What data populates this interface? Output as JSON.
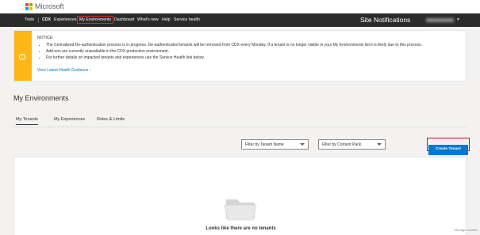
{
  "brand": {
    "name": "Microsoft",
    "logo_colors": [
      "#f25022",
      "#7fba00",
      "#00a4ef",
      "#ffb900"
    ]
  },
  "nav": {
    "items": [
      {
        "label": "Tools"
      },
      {
        "label": "CDX"
      },
      {
        "label": "Experiences"
      },
      {
        "label": "My Environments",
        "active": true
      },
      {
        "label": "Dashboard"
      },
      {
        "label": "What's new"
      },
      {
        "label": "Help"
      },
      {
        "label": "Service health"
      }
    ],
    "site_notifications": "Site Notifications"
  },
  "notice": {
    "title": "NOTICE:",
    "bullets": [
      "The Centralized De-authentication process is in progress. De-authenticated tenants will be removed from CDX every Monday. If a tenant is no longer visible in your My Environments list it is likely due to this process.",
      "Add-ons are currently unavailable in the CDX production environment.",
      "For further details on impacted tenants and experiences use the Service Health link below."
    ],
    "link": "View Latest Health Guidance",
    "icon": "info-icon",
    "accent": "#fcb615"
  },
  "main": {
    "title": "My Environments",
    "tabs": [
      {
        "label": "My Tenants",
        "active": true
      },
      {
        "label": "My Experiences"
      },
      {
        "label": "Roles & Limits"
      }
    ],
    "filters": [
      {
        "label": "Filter by Tenant Name"
      },
      {
        "label": "Filter by Content Pack"
      }
    ],
    "create_button": "Create Tenant",
    "create_button_color": "#0078d4",
    "empty_message": "Looks like there are no tenants",
    "empty_icon": "folder-icon"
  },
  "footer": {
    "manage_tools": "Manage cookies"
  }
}
